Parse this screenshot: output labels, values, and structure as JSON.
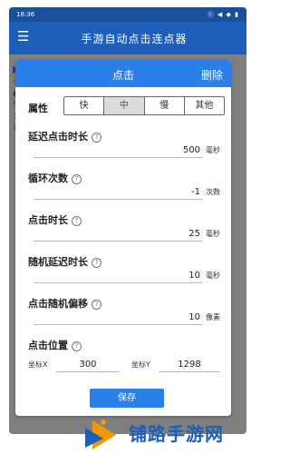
{
  "status_bar": {
    "time": "18:36",
    "icons": "ⓝ ◀ ◆ ▮"
  },
  "app_bar": {
    "title": "手游自动点击连点器",
    "menu_icon": "menu-icon"
  },
  "background_icons": [
    "▶",
    "+",
    "●",
    "✎",
    "✕",
    "⌇"
  ],
  "dialog": {
    "title": "点击",
    "delete_label": "删除",
    "attribute": {
      "label": "属性",
      "options": [
        "快",
        "中",
        "慢",
        "其他"
      ],
      "selected": "中"
    },
    "fields": [
      {
        "label": "延迟点击时长",
        "value": "500",
        "unit": "毫秒"
      },
      {
        "label": "循环次数",
        "value": "-1",
        "unit": "次数"
      },
      {
        "label": "点击时长",
        "value": "25",
        "unit": "毫秒"
      },
      {
        "label": "随机延迟时长",
        "value": "10",
        "unit": "毫秒"
      },
      {
        "label": "点击随机偏移",
        "value": "10",
        "unit": "像素"
      }
    ],
    "position": {
      "label": "点击位置",
      "x_label": "坐标X",
      "x_value": "300",
      "y_label": "坐标Y",
      "y_value": "1298"
    },
    "save_label": "保存"
  },
  "watermark": {
    "text": "铺路手游网"
  },
  "colors": {
    "primary": "#1d5fb8",
    "dialog_header": "#2a7fe8",
    "overlay": "#7f7f7f",
    "logo_orange": "#f39800"
  }
}
